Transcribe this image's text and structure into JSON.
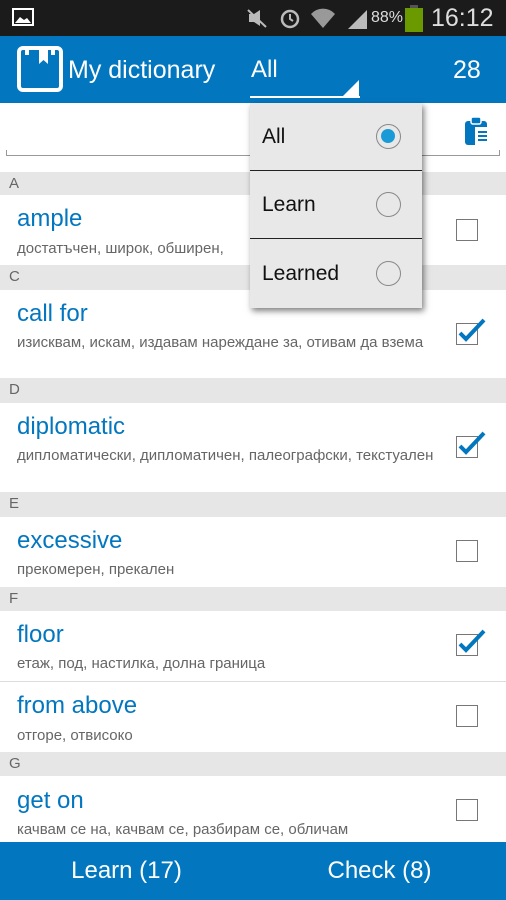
{
  "status": {
    "battery": "88%",
    "time": "16:12",
    "icons": [
      "image-icon",
      "mute-icon",
      "alarm-icon",
      "wifi-icon",
      "signal-icon",
      "battery-icon"
    ]
  },
  "header": {
    "title": "My dictionary",
    "filter": "All",
    "count": "28"
  },
  "colors": {
    "accent": "#0277c0",
    "section": "#e6e6e6"
  },
  "filter_menu": {
    "options": [
      {
        "label": "All",
        "selected": true
      },
      {
        "label": "Learn",
        "selected": false
      },
      {
        "label": "Learned",
        "selected": false
      }
    ]
  },
  "sections": {
    "a": "A",
    "c": "C",
    "d": "D",
    "e": "E",
    "f": "F",
    "g": "G"
  },
  "words": [
    {
      "word": "ample",
      "translation": "достатъчен, широк, обширен,",
      "checked": false
    },
    {
      "word": "call for",
      "translation": "изисквам, искам, издавам нареждане за, отивам да взема",
      "checked": true
    },
    {
      "word": "diplomatic",
      "translation": "дипломатически, дипломатичен, палеографски, текстуален",
      "checked": true
    },
    {
      "word": "excessive",
      "translation": "прекомерен, прекален",
      "checked": false
    },
    {
      "word": "floor",
      "translation": "етаж, под, настилка, долна граница",
      "checked": true
    },
    {
      "word": "from above",
      "translation": "отгоре, отвисоко",
      "checked": false
    },
    {
      "word": "get on",
      "translation": "качвам се на, качвам се, разбирам се, обличам",
      "checked": false
    }
  ],
  "bottom": {
    "learn": "Learn (17)",
    "check": "Check (8)"
  }
}
